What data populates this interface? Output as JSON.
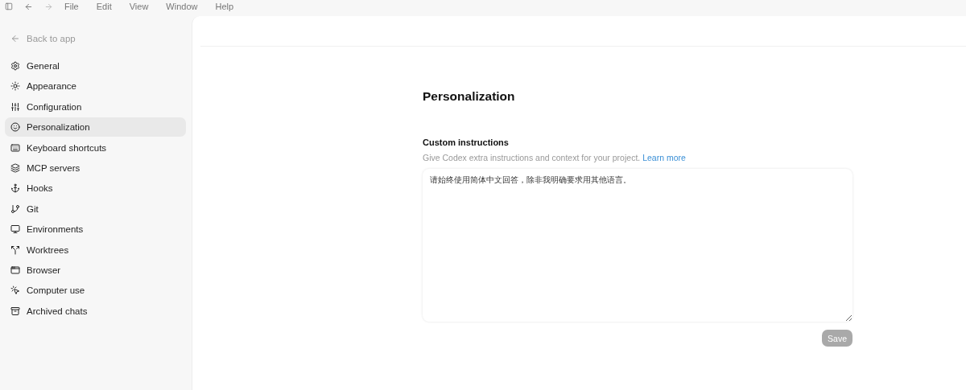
{
  "menu_bar": {
    "items": [
      "File",
      "Edit",
      "View",
      "Window",
      "Help"
    ]
  },
  "sidebar": {
    "back_link": "Back to app",
    "items": [
      {
        "label": "General",
        "selected": false
      },
      {
        "label": "Appearance",
        "selected": false
      },
      {
        "label": "Configuration",
        "selected": false
      },
      {
        "label": "Personalization",
        "selected": true
      },
      {
        "label": "Keyboard shortcuts",
        "selected": false
      },
      {
        "label": "MCP servers",
        "selected": false
      },
      {
        "label": "Hooks",
        "selected": false
      },
      {
        "label": "Git",
        "selected": false
      },
      {
        "label": "Environments",
        "selected": false
      },
      {
        "label": "Worktrees",
        "selected": false
      },
      {
        "label": "Browser",
        "selected": false
      },
      {
        "label": "Computer use",
        "selected": false
      },
      {
        "label": "Archived chats",
        "selected": false
      }
    ]
  },
  "page": {
    "title": "Personalization",
    "section": {
      "title": "Custom instructions",
      "description": "Give Codex extra instructions and context for your project.",
      "link": "Learn more",
      "value": "请始终使用简体中文回答，除非我明确要求用其他语言。",
      "save_button": {
        "label": "Save",
        "disabled": true
      }
    }
  }
}
